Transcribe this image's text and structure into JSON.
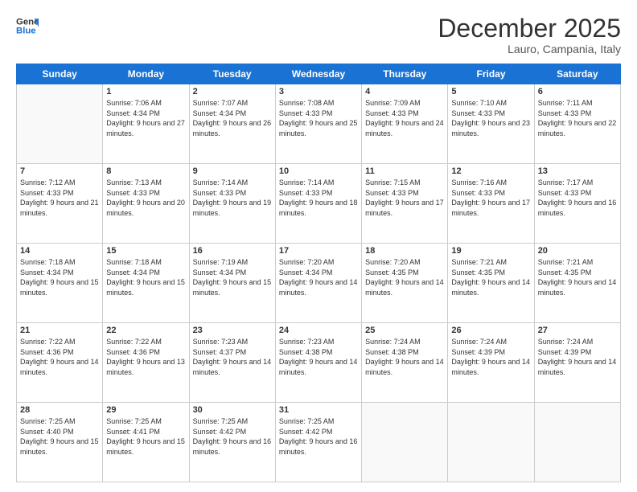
{
  "header": {
    "logo_line1": "General",
    "logo_line2": "Blue",
    "month_title": "December 2025",
    "location": "Lauro, Campania, Italy"
  },
  "weekdays": [
    "Sunday",
    "Monday",
    "Tuesday",
    "Wednesday",
    "Thursday",
    "Friday",
    "Saturday"
  ],
  "weeks": [
    [
      {
        "day": "",
        "sunrise": "",
        "sunset": "",
        "daylight": ""
      },
      {
        "day": "1",
        "sunrise": "7:06 AM",
        "sunset": "4:34 PM",
        "daylight": "9 hours and 27 minutes."
      },
      {
        "day": "2",
        "sunrise": "7:07 AM",
        "sunset": "4:34 PM",
        "daylight": "9 hours and 26 minutes."
      },
      {
        "day": "3",
        "sunrise": "7:08 AM",
        "sunset": "4:33 PM",
        "daylight": "9 hours and 25 minutes."
      },
      {
        "day": "4",
        "sunrise": "7:09 AM",
        "sunset": "4:33 PM",
        "daylight": "9 hours and 24 minutes."
      },
      {
        "day": "5",
        "sunrise": "7:10 AM",
        "sunset": "4:33 PM",
        "daylight": "9 hours and 23 minutes."
      },
      {
        "day": "6",
        "sunrise": "7:11 AM",
        "sunset": "4:33 PM",
        "daylight": "9 hours and 22 minutes."
      }
    ],
    [
      {
        "day": "7",
        "sunrise": "7:12 AM",
        "sunset": "4:33 PM",
        "daylight": "9 hours and 21 minutes."
      },
      {
        "day": "8",
        "sunrise": "7:13 AM",
        "sunset": "4:33 PM",
        "daylight": "9 hours and 20 minutes."
      },
      {
        "day": "9",
        "sunrise": "7:14 AM",
        "sunset": "4:33 PM",
        "daylight": "9 hours and 19 minutes."
      },
      {
        "day": "10",
        "sunrise": "7:14 AM",
        "sunset": "4:33 PM",
        "daylight": "9 hours and 18 minutes."
      },
      {
        "day": "11",
        "sunrise": "7:15 AM",
        "sunset": "4:33 PM",
        "daylight": "9 hours and 17 minutes."
      },
      {
        "day": "12",
        "sunrise": "7:16 AM",
        "sunset": "4:33 PM",
        "daylight": "9 hours and 17 minutes."
      },
      {
        "day": "13",
        "sunrise": "7:17 AM",
        "sunset": "4:33 PM",
        "daylight": "9 hours and 16 minutes."
      }
    ],
    [
      {
        "day": "14",
        "sunrise": "7:18 AM",
        "sunset": "4:34 PM",
        "daylight": "9 hours and 15 minutes."
      },
      {
        "day": "15",
        "sunrise": "7:18 AM",
        "sunset": "4:34 PM",
        "daylight": "9 hours and 15 minutes."
      },
      {
        "day": "16",
        "sunrise": "7:19 AM",
        "sunset": "4:34 PM",
        "daylight": "9 hours and 15 minutes."
      },
      {
        "day": "17",
        "sunrise": "7:20 AM",
        "sunset": "4:34 PM",
        "daylight": "9 hours and 14 minutes."
      },
      {
        "day": "18",
        "sunrise": "7:20 AM",
        "sunset": "4:35 PM",
        "daylight": "9 hours and 14 minutes."
      },
      {
        "day": "19",
        "sunrise": "7:21 AM",
        "sunset": "4:35 PM",
        "daylight": "9 hours and 14 minutes."
      },
      {
        "day": "20",
        "sunrise": "7:21 AM",
        "sunset": "4:35 PM",
        "daylight": "9 hours and 14 minutes."
      }
    ],
    [
      {
        "day": "21",
        "sunrise": "7:22 AM",
        "sunset": "4:36 PM",
        "daylight": "9 hours and 14 minutes."
      },
      {
        "day": "22",
        "sunrise": "7:22 AM",
        "sunset": "4:36 PM",
        "daylight": "9 hours and 13 minutes."
      },
      {
        "day": "23",
        "sunrise": "7:23 AM",
        "sunset": "4:37 PM",
        "daylight": "9 hours and 14 minutes."
      },
      {
        "day": "24",
        "sunrise": "7:23 AM",
        "sunset": "4:38 PM",
        "daylight": "9 hours and 14 minutes."
      },
      {
        "day": "25",
        "sunrise": "7:24 AM",
        "sunset": "4:38 PM",
        "daylight": "9 hours and 14 minutes."
      },
      {
        "day": "26",
        "sunrise": "7:24 AM",
        "sunset": "4:39 PM",
        "daylight": "9 hours and 14 minutes."
      },
      {
        "day": "27",
        "sunrise": "7:24 AM",
        "sunset": "4:39 PM",
        "daylight": "9 hours and 14 minutes."
      }
    ],
    [
      {
        "day": "28",
        "sunrise": "7:25 AM",
        "sunset": "4:40 PM",
        "daylight": "9 hours and 15 minutes."
      },
      {
        "day": "29",
        "sunrise": "7:25 AM",
        "sunset": "4:41 PM",
        "daylight": "9 hours and 15 minutes."
      },
      {
        "day": "30",
        "sunrise": "7:25 AM",
        "sunset": "4:42 PM",
        "daylight": "9 hours and 16 minutes."
      },
      {
        "day": "31",
        "sunrise": "7:25 AM",
        "sunset": "4:42 PM",
        "daylight": "9 hours and 16 minutes."
      },
      {
        "day": "",
        "sunrise": "",
        "sunset": "",
        "daylight": ""
      },
      {
        "day": "",
        "sunrise": "",
        "sunset": "",
        "daylight": ""
      },
      {
        "day": "",
        "sunrise": "",
        "sunset": "",
        "daylight": ""
      }
    ]
  ]
}
